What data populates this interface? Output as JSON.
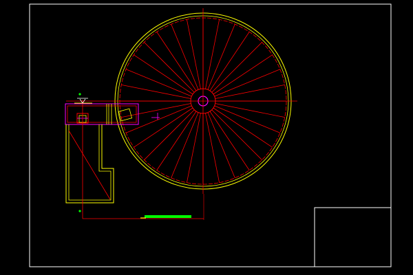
{
  "drawing": {
    "background": "#000000",
    "colors": {
      "frame": "#ffffff",
      "outline": "#ffff00",
      "center_lines": "#ff0000",
      "hub": "#ff00ff",
      "accent_bar": "#00ff00",
      "marker": "#00ff00",
      "dimension": "#ff00ff"
    },
    "wheel": {
      "spoke_count": 32
    },
    "icons": {
      "tank_symbol": "circle-with-spokes",
      "north_marker": "arrow-marker-icon"
    }
  }
}
